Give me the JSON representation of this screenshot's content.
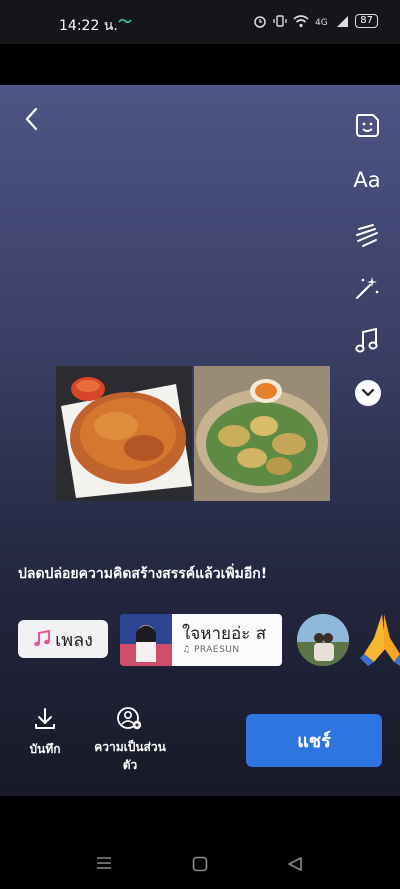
{
  "status_bar": {
    "time": "14:22 น.",
    "battery": "87"
  },
  "toolbar": {
    "text_tool_label": "Aa"
  },
  "caption": "ปลดปล่อยความคิดสร้างสรรค์แล้วเพิ่มอีก!",
  "music": {
    "chip_label": "เพลง",
    "song_title": "ใจหายอ่ะ ส",
    "song_artist": "PRAESUN"
  },
  "bottom": {
    "save_label": "บันทึก",
    "privacy_label": "ความเป็นส่วนตัว",
    "share_label": "แชร์"
  },
  "colors": {
    "share_button": "#2f75e0",
    "accent_pink": "#e4559b"
  }
}
